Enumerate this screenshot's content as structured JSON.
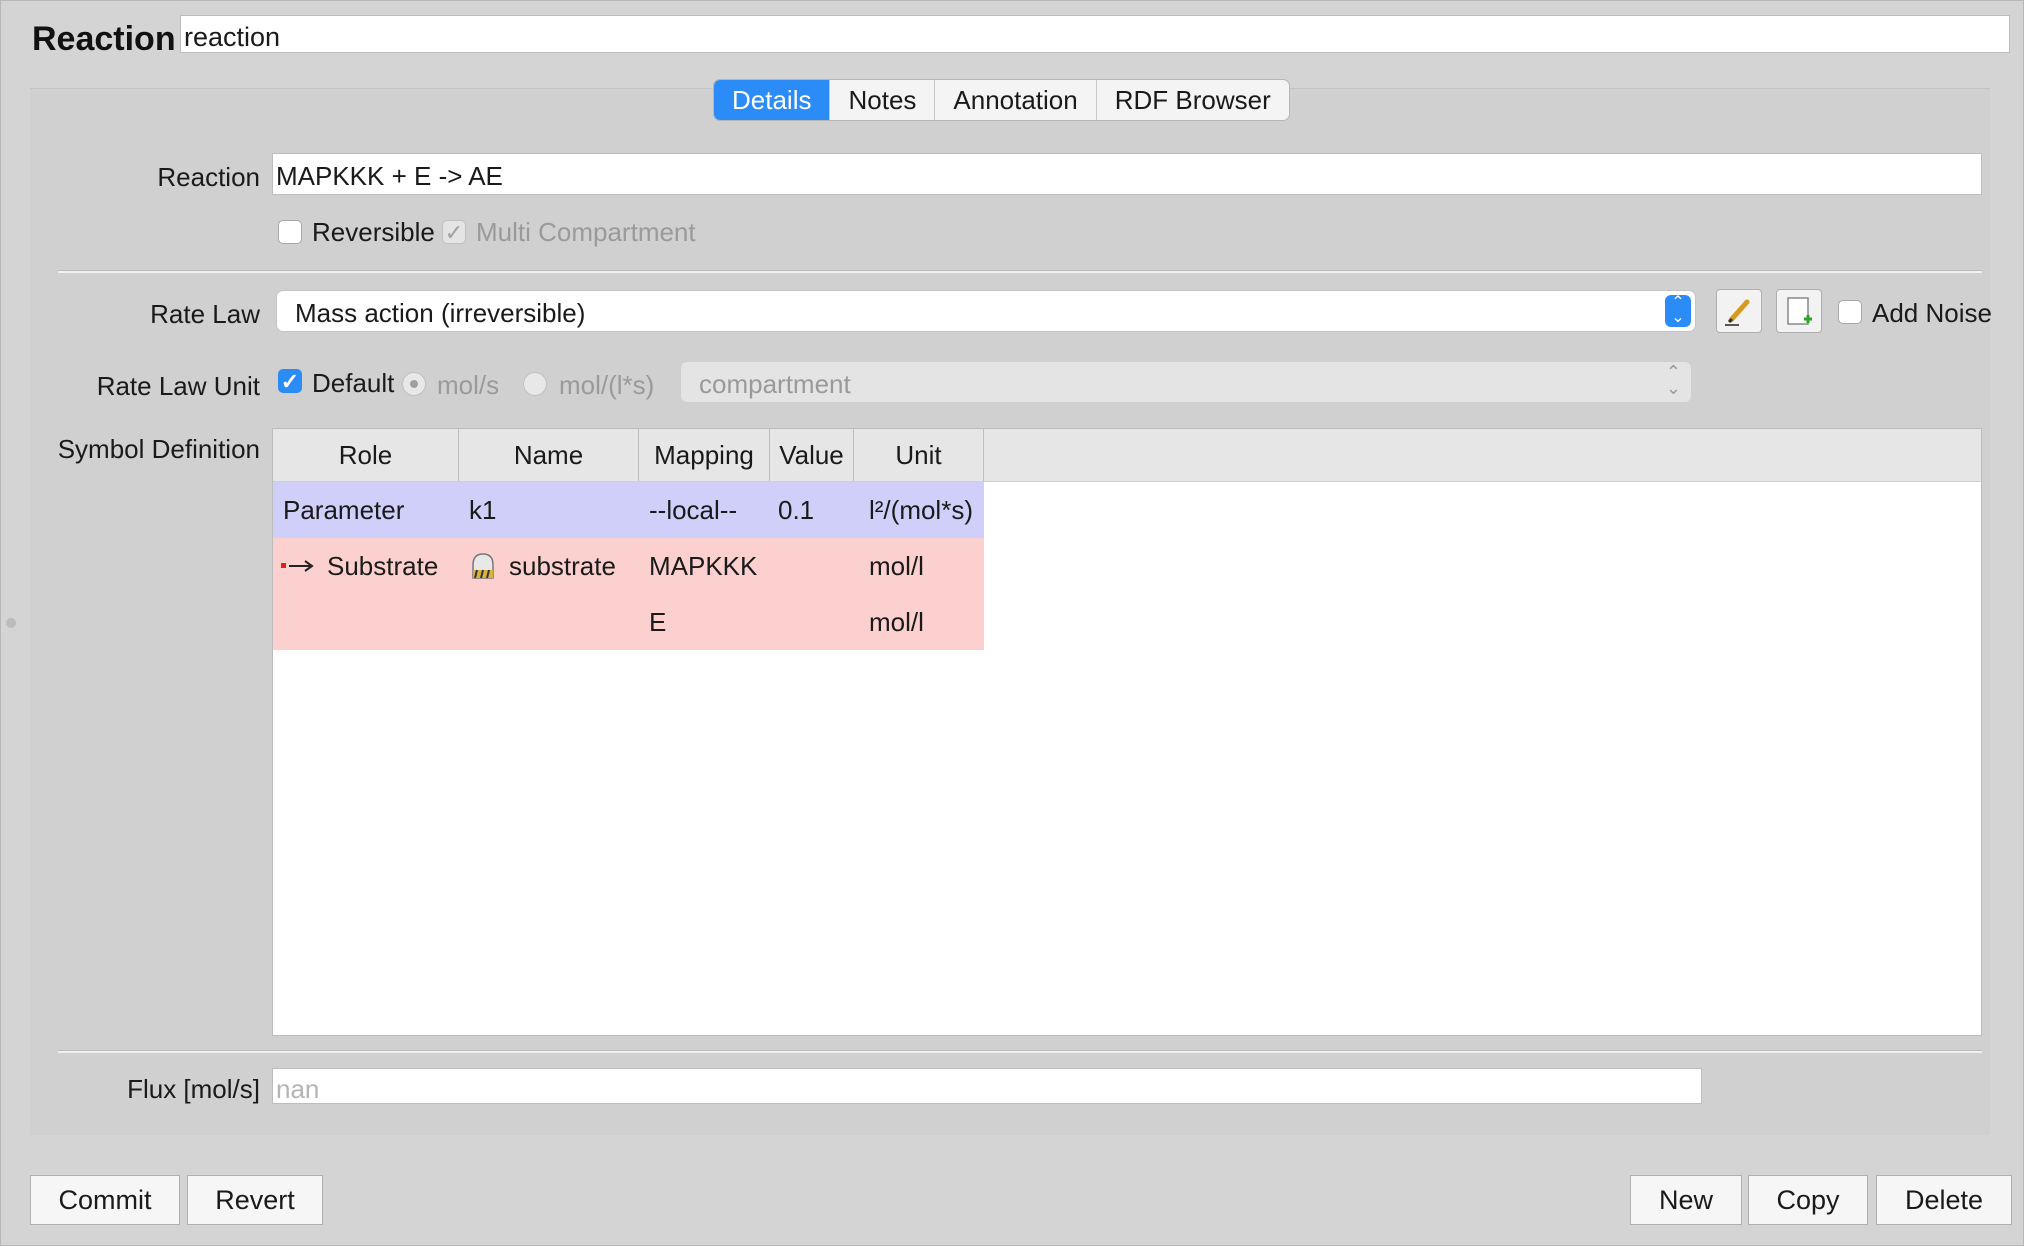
{
  "header": {
    "title": "Reaction",
    "name_value": "reaction"
  },
  "tabs": [
    {
      "label": "Details",
      "active": true
    },
    {
      "label": "Notes",
      "active": false
    },
    {
      "label": "Annotation",
      "active": false
    },
    {
      "label": "RDF Browser",
      "active": false
    }
  ],
  "details": {
    "reaction_label": "Reaction",
    "reaction_equation": "MAPKKK + E -> AE",
    "reversible_label": "Reversible",
    "reversible_checked": false,
    "multi_compartment_label": "Multi Compartment",
    "multi_compartment_checked": true,
    "rate_law_label": "Rate Law",
    "rate_law_value": "Mass action (irreversible)",
    "add_noise_label": "Add Noise",
    "rate_law_unit_label": "Rate Law Unit",
    "default_label": "Default",
    "default_checked": true,
    "unit_option_1": "mol/s",
    "unit_option_2": "mol/(l*s)",
    "compartment_placeholder": "compartment",
    "symbol_definition_label": "Symbol Definition",
    "flux_label": "Flux [mol/s]",
    "flux_placeholder": "nan"
  },
  "symbol_table": {
    "columns": [
      "Role",
      "Name",
      "Mapping",
      "Value",
      "Unit"
    ],
    "rows": [
      {
        "role": "Parameter",
        "name": "k1",
        "mapping": "--local--",
        "value": "0.1",
        "unit": "l²/(mol*s)",
        "color": "#cfcffa"
      },
      {
        "role": "Substrate",
        "name": "substrate",
        "mapping": "MAPKKK",
        "value": "",
        "unit": "mol/l",
        "color": "#fdd0d0"
      },
      {
        "role": "",
        "name": "",
        "mapping": "E",
        "value": "",
        "unit": "mol/l",
        "color": "#fdd0d0"
      }
    ]
  },
  "buttons": {
    "commit": "Commit",
    "revert": "Revert",
    "new": "New",
    "copy": "Copy",
    "delete": "Delete"
  },
  "colors": {
    "accent": "#2b8cf7",
    "parameter_row": "#cfcffa",
    "substrate_row": "#fdd0d0"
  },
  "icons": {
    "edit": "pencil-icon",
    "new_function": "new-document-icon",
    "substrate_role": "arrow-right-icon",
    "species": "species-icon"
  }
}
